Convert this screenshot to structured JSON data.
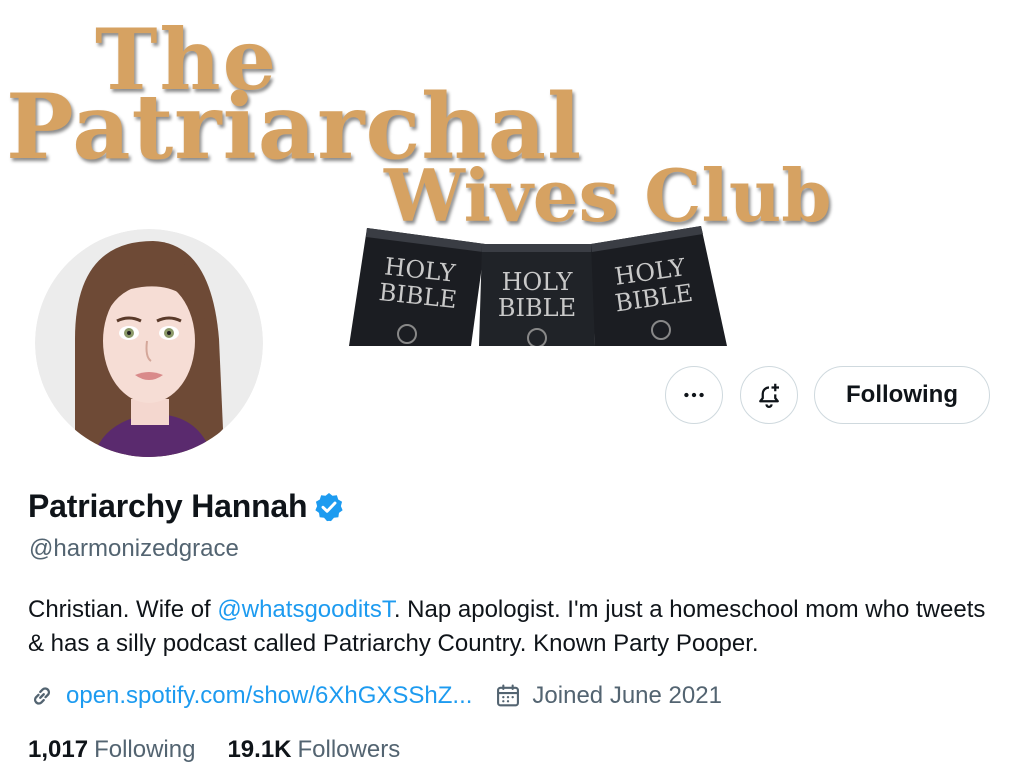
{
  "banner": {
    "line1": "The",
    "line2": "Patriarchal",
    "line3": "Wives Club",
    "book_label_top": "HOLY",
    "book_label_bottom": "BIBLE",
    "text_color": "#d6a262"
  },
  "actions": {
    "more_icon": "more-horizontal-icon",
    "notify_icon": "bell-plus-icon",
    "follow_label": "Following"
  },
  "profile": {
    "display_name": "Patriarchy Hannah",
    "verified_icon": "verified-badge-icon",
    "handle": "@harmonizedgrace",
    "bio_prefix": "Christian. Wife of ",
    "bio_mention": "@whatsgooditsT",
    "bio_suffix": ". Nap apologist. I'm just a homeschool mom who tweets & has a silly podcast called Patriarchy Country. Known Party Pooper.",
    "link_icon": "link-icon",
    "link": "open.spotify.com/show/6XhGXSShZ...",
    "calendar_icon": "calendar-icon",
    "joined": "Joined June 2021"
  },
  "stats": {
    "following_count": "1,017",
    "following_label": "Following",
    "followers_count": "19.1K",
    "followers_label": "Followers"
  },
  "colors": {
    "accent": "#1d9bf0",
    "text_primary": "#0f1419",
    "text_secondary": "#536471",
    "border": "#cfd9de"
  }
}
